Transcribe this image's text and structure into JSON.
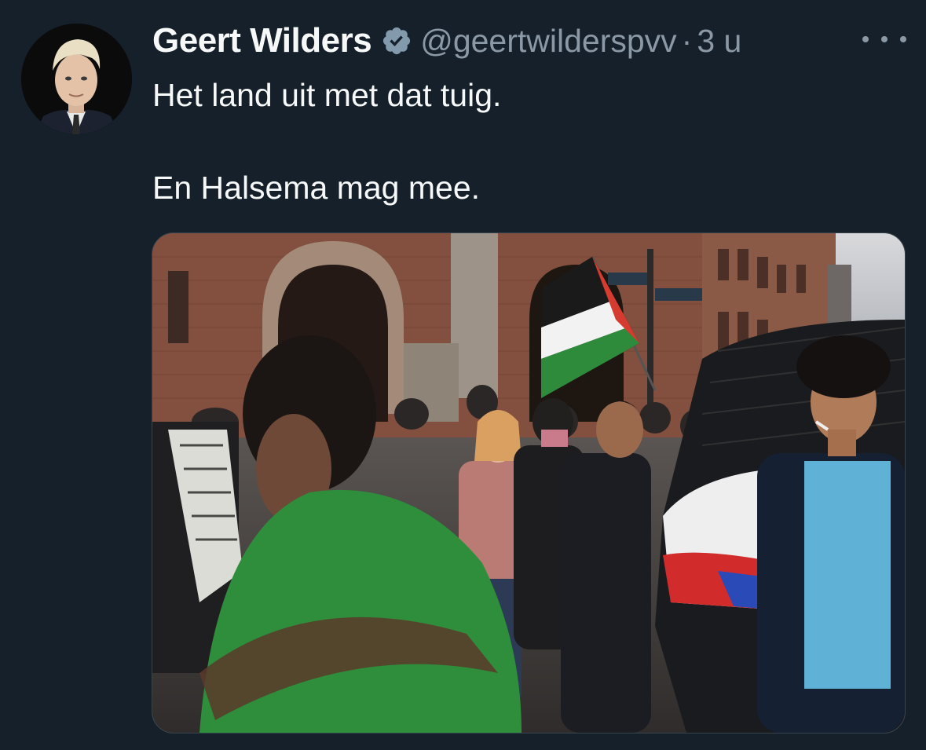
{
  "author": {
    "display_name": "Geert Wilders",
    "handle": "@geertwilderspvv",
    "separator": "·",
    "timestamp": "3 u",
    "verified_icon": "verified-badge-icon"
  },
  "tweet": {
    "line1": "Het land uit met dat tuig.",
    "line2": "En Halsema mag mee."
  },
  "actions": {
    "more_icon": "more-options-icon"
  },
  "colors": {
    "background": "#15202b",
    "primary_text": "#f7f9f9",
    "secondary_text": "#8b98a5",
    "verified_badge": "#829aab",
    "border": "#38444d"
  }
}
